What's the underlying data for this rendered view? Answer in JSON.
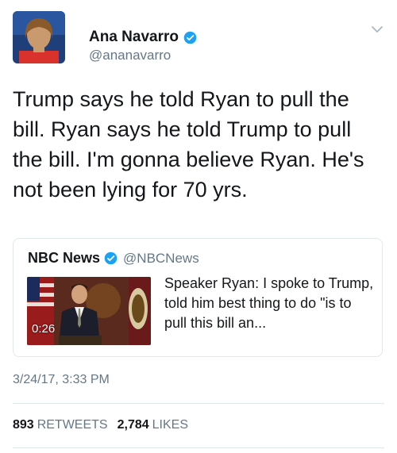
{
  "tweet": {
    "author": {
      "name": "Ana Navarro",
      "handle": "@ananavarro"
    },
    "text": "Trump says he told Ryan to pull the bill. Ryan says he told Trump to pull the bill. I'm gonna believe Ryan. He's not been lying for 70 yrs.",
    "timestamp": "3/24/17, 3:33 PM"
  },
  "card": {
    "source_name": "NBC News",
    "source_handle": "@NBCNews",
    "video_duration": "0:26",
    "text": "Speaker Ryan: I spoke to Trump, told him best thing to do \"is to pull this bill an..."
  },
  "stats": {
    "retweets_count": "893",
    "retweets_label": "RETWEETS",
    "likes_count": "2,784",
    "likes_label": "LIKES"
  },
  "colors": {
    "verified_blue": "#1da1f2",
    "secondary_text": "#657786",
    "divider": "#e1e8ed"
  }
}
